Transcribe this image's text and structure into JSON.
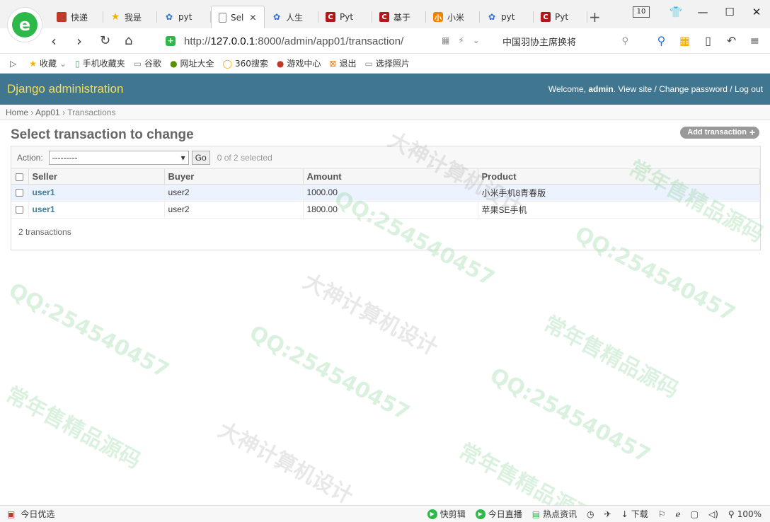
{
  "browser": {
    "tabs": [
      {
        "label": "快递",
        "icon": "red-square-icon"
      },
      {
        "label": "我是",
        "icon": "star-icon"
      },
      {
        "label": "pyt",
        "icon": "paw-icon"
      },
      {
        "label": "Sel",
        "icon": "document-icon",
        "active": true
      },
      {
        "label": "人生",
        "icon": "paw-icon"
      },
      {
        "label": "Pyt",
        "icon": "c-red-icon"
      },
      {
        "label": "基于",
        "icon": "c-red-icon"
      },
      {
        "label": "小米",
        "icon": "orange-square-icon"
      },
      {
        "label": "pyt",
        "icon": "paw-icon"
      },
      {
        "label": "Pyt",
        "icon": "c-red-icon"
      }
    ],
    "tab_count": "10",
    "url_prefix": "http://",
    "url_host": "127.0.0.1",
    "url_rest": ":8000/admin/app01/transaction/",
    "search_text": "中国羽协主席换将",
    "bookmarks": [
      {
        "label": "收藏",
        "icon": "star-icon"
      },
      {
        "label": "手机收藏夹",
        "icon": "phone-icon"
      },
      {
        "label": "谷歌",
        "icon": "document-icon"
      },
      {
        "label": "网址大全",
        "icon": "globe-icon"
      },
      {
        "label": "360搜索",
        "icon": "search-circle-icon"
      },
      {
        "label": "游戏中心",
        "icon": "game-icon"
      },
      {
        "label": "退出",
        "icon": "exit-icon"
      },
      {
        "label": "选择照片",
        "icon": "document-icon"
      }
    ],
    "status": {
      "left_label": "今日优选",
      "kuaijianji": "快剪辑",
      "live": "今日直播",
      "news": "热点资讯",
      "download": "下载",
      "zoom": "100%"
    }
  },
  "admin": {
    "site_title": "Django administration",
    "welcome_prefix": "Welcome, ",
    "username": "admin",
    "welcome_suffix": ".",
    "view_site": "View site",
    "change_password": "Change password",
    "log_out": "Log out",
    "breadcrumbs": [
      "Home",
      "App01",
      "Transactions"
    ],
    "page_title": "Select transaction to change",
    "add_button": "Add transaction",
    "action_label": "Action:",
    "action_value": "---------",
    "go_label": "Go",
    "selected_text": "0 of 2 selected",
    "columns": [
      "Seller",
      "Buyer",
      "Amount",
      "Product"
    ],
    "rows": [
      {
        "seller": "user1",
        "buyer": "user2",
        "amount": "1000.00",
        "product": "小米手机8青春版"
      },
      {
        "seller": "user1",
        "buyer": "user2",
        "amount": "1800.00",
        "product": "苹果SE手机"
      }
    ],
    "paginator": "2 transactions"
  },
  "watermark": {
    "qq": "QQ:254540457",
    "line1": "大神计算机设计",
    "line2": "常年售精品源码"
  },
  "colors": {
    "header_bg": "#417690",
    "branding": "#f5dd5d",
    "link": "#447e9b",
    "row_highlight": "#edf3fe"
  }
}
